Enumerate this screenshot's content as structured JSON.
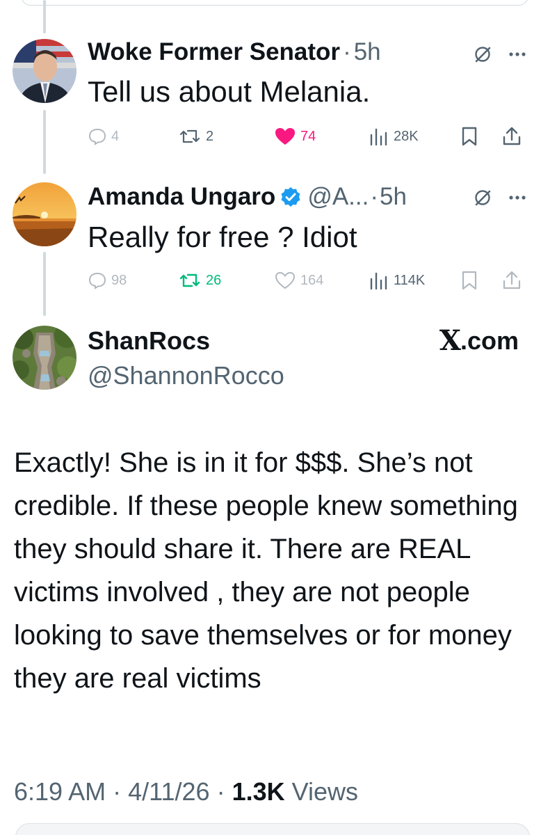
{
  "replies": [
    {
      "name": "Woke Former Senator",
      "separator": "·",
      "time": "5h",
      "text": "Tell us about Melania.",
      "stats": {
        "replies": "4",
        "reposts": "2",
        "likes": "74",
        "views": "28K"
      },
      "liked": true,
      "like_color": "#f91880"
    },
    {
      "name": "Amanda Ungaro",
      "handle": "@A...",
      "separator": "·",
      "time": "5h",
      "text": "Really for free ? Idiot",
      "stats": {
        "replies": "98",
        "reposts": "26",
        "likes": "164",
        "views": "114K"
      },
      "reposted": true,
      "repost_color": "#00ba7c",
      "verified_color": "#1d9bf0"
    }
  ],
  "main_post": {
    "name": "ShanRocs",
    "handle": "@ShannonRocco",
    "source_logo": "X",
    "source_suffix": ".com",
    "text": "Exactly!  She is in it for $$$.  She’s not credible.  If these people knew something they should share it. There are REAL victims involved , they are not people looking to save themselves or for money they are real victims",
    "time": "6:19 AM",
    "date": "4/11/26",
    "separator": "·",
    "views_count": "1.3K",
    "views_label": "Views"
  },
  "icons": {
    "reply": "comment-bubble-icon",
    "repost": "repost-icon",
    "like": "heart-icon",
    "views": "bar-chart-icon",
    "bookmark": "bookmark-icon",
    "share": "share-upload-icon",
    "grok": "grok-slash-icon",
    "more": "more-dots-icon",
    "verified": "verified-badge-icon"
  }
}
